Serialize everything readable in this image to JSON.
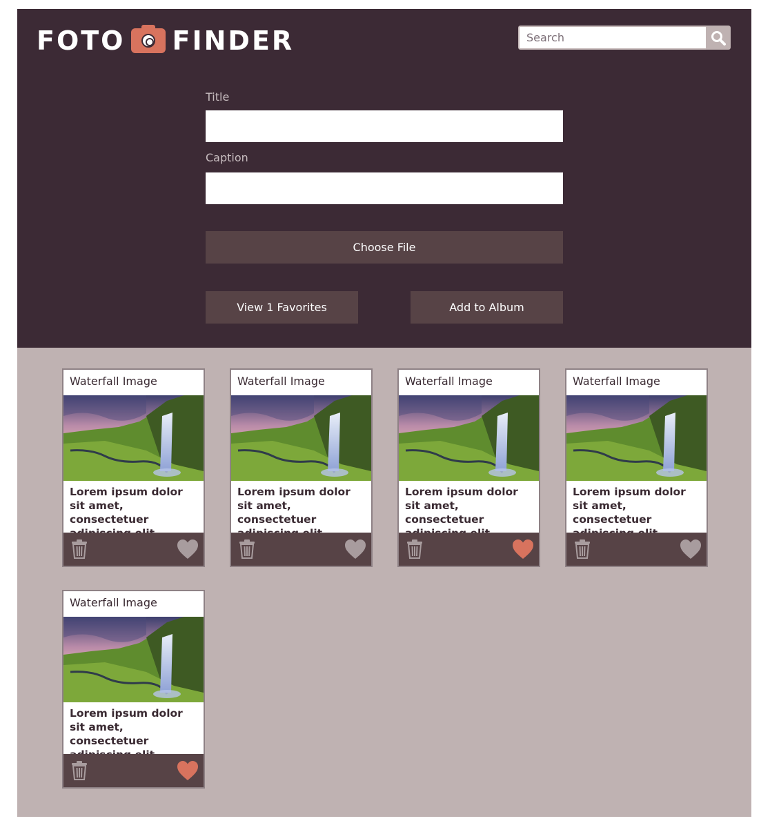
{
  "app": {
    "logo_left": "FOTO",
    "logo_right": "FINDER",
    "search_placeholder": "Search"
  },
  "form": {
    "title_label": "Title",
    "title_value": "",
    "caption_label": "Caption",
    "caption_value": "",
    "choose_file_label": "Choose File",
    "view_favorites_label": "View 1 Favorites",
    "add_album_label": "Add to Album"
  },
  "colors": {
    "header_bg": "#3c2a35",
    "gallery_bg": "#bfb2b2",
    "button_bg": "#574346",
    "accent": "#d8735e",
    "heart_inactive": "#a89c9e"
  },
  "cards": [
    {
      "title": "Waterfall Image",
      "caption": "Lorem ipsum dolor sit amet, consectetuer adipiscing elit.",
      "favorite": false,
      "image": "waterfall-landscape"
    },
    {
      "title": "Waterfall Image",
      "caption": "Lorem ipsum dolor sit amet, consectetuer adipiscing elit.",
      "favorite": false,
      "image": "waterfall-landscape"
    },
    {
      "title": "Waterfall Image",
      "caption": "Lorem ipsum dolor sit amet, consectetuer adipiscing elit.",
      "favorite": true,
      "image": "waterfall-landscape"
    },
    {
      "title": "Waterfall Image",
      "caption": "Lorem ipsum dolor sit amet, consectetuer adipiscing elit.",
      "favorite": false,
      "image": "waterfall-landscape"
    },
    {
      "title": "Waterfall Image",
      "caption": "Lorem ipsum dolor sit amet, consectetuer adipiscing elit.",
      "favorite": true,
      "image": "waterfall-landscape"
    }
  ],
  "icons": {
    "logo": "camera-icon",
    "search": "search-icon",
    "delete": "trash-icon",
    "favorite": "heart-icon"
  }
}
